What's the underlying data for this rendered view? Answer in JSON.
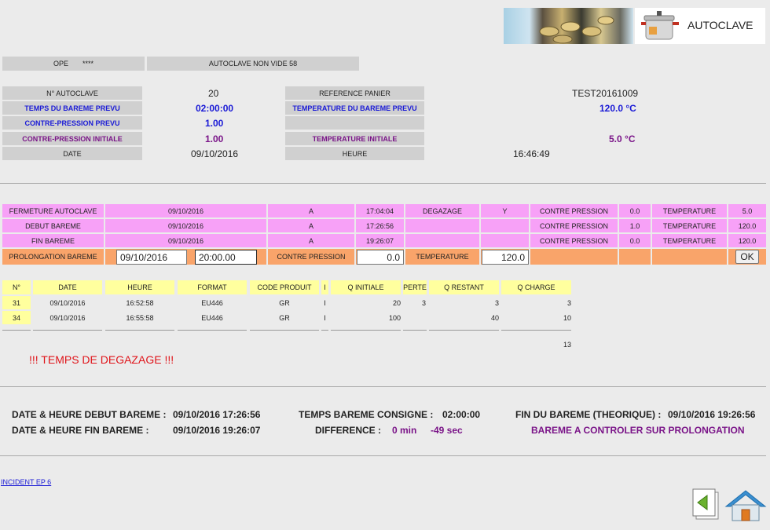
{
  "header": {
    "title": "AUTOCLAVE"
  },
  "info_bar": {
    "ope_label": "OPE",
    "ope_value": "****",
    "autoclave_name": "AUTOCLAVE NON VIDE 58"
  },
  "params": {
    "n_autoclave_label": "N° AUTOCLAVE",
    "n_autoclave_value": "20",
    "temps_bareme_label": "TEMPS DU BAREME PREVU",
    "temps_bareme_value": "02:00:00",
    "contre_pression_prevu_label": "CONTRE-PRESSION PREVU",
    "contre_pression_prevu_value": "1.00",
    "contre_pression_initiale_label": "CONTRE-PRESSION INITIALE",
    "contre_pression_initiale_value": "1.00",
    "date_label": "DATE",
    "date_value": "09/10/2016",
    "reference_panier_label": "REFERENCE PANIER",
    "reference_panier_value": "TEST20161009",
    "temperature_bareme_label": "TEMPERATURE DU BAREME PREVU",
    "temperature_bareme_value": "120.0 °C",
    "temperature_initiale_label": "TEMPERATURE INITIALE",
    "temperature_initiale_value": "5.0 °C",
    "heure_label": "HEURE",
    "heure_value": "16:46:49"
  },
  "events": {
    "fermeture": {
      "label": "FERMETURE AUTOCLAVE",
      "date": "09/10/2016",
      "a": "A",
      "time": "17:04:04",
      "degazage_label": "DEGAZAGE",
      "degazage_value": "Y",
      "cp_label": "CONTRE PRESSION",
      "cp_value": "0.0",
      "temp_label": "TEMPERATURE",
      "temp_value": "5.0"
    },
    "debut": {
      "label": "DEBUT BAREME",
      "date": "09/10/2016",
      "a": "A",
      "time": "17:26:56",
      "cp_label": "CONTRE PRESSION",
      "cp_value": "1.0",
      "temp_label": "TEMPERATURE",
      "temp_value": "120.0"
    },
    "fin": {
      "label": "FIN BAREME",
      "date": "09/10/2016",
      "a": "A",
      "time": "19:26:07",
      "cp_label": "CONTRE PRESSION",
      "cp_value": "0.0",
      "temp_label": "TEMPERATURE",
      "temp_value": "120.0"
    },
    "prolongation": {
      "label": "PROLONGATION BAREME",
      "date_value": "09/10/2016",
      "time_value": "20:00.00",
      "cp_label": "CONTRE PRESSION",
      "cp_value": "0.0",
      "temp_label": "TEMPERATURE",
      "temp_value": "120.0",
      "ok_label": "OK"
    }
  },
  "products": {
    "headers": [
      "N°",
      "DATE",
      "HEURE",
      "FORMAT",
      "CODE PRODUIT",
      "I",
      "Q INITIALE",
      "PERTE",
      "Q RESTANT",
      "Q CHARGE"
    ],
    "rows": [
      [
        "31",
        "09/10/2016",
        "16:52:58",
        "EU446",
        "GR",
        "I",
        "20",
        "3",
        "3",
        "3"
      ],
      [
        "34",
        "09/10/2016",
        "16:55:58",
        "EU446",
        "GR",
        "I",
        "100",
        "",
        "40",
        "10"
      ]
    ],
    "total_charge": "13"
  },
  "alert": "!!! TEMPS DE DEGAZAGE !!!",
  "summary": {
    "debut_label": "DATE & HEURE DEBUT BAREME :",
    "debut_value": "09/10/2016 17:26:56",
    "fin_label": "DATE & HEURE FIN BAREME :",
    "fin_value": "09/10/2016 19:26:07",
    "consigne_label": "TEMPS BAREME CONSIGNE :",
    "consigne_value": "02:00:00",
    "difference_label": "DIFFERENCE :",
    "difference_min": "0 min",
    "difference_sec": "-49 sec",
    "fin_theorique_label": "FIN DU BAREME (THEORIQUE) :",
    "fin_theorique_value": "09/10/2016 19:26:56",
    "status": "BAREME A CONTROLER SUR PROLONGATION"
  },
  "footer": {
    "incident_link": "INCIDENT EP 6"
  },
  "icons": {
    "back": "back-arrow-icon",
    "home": "home-icon",
    "autoclave_photo": "autoclave-icon"
  }
}
